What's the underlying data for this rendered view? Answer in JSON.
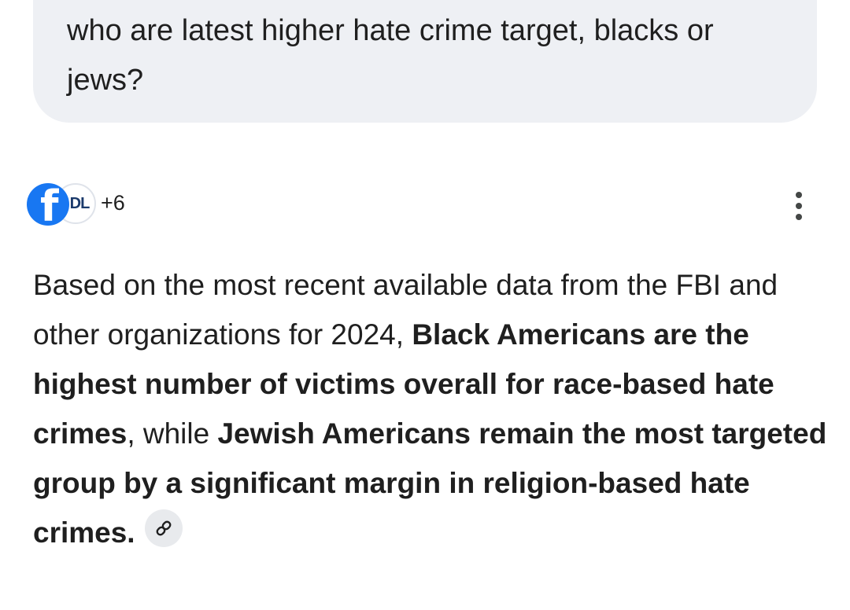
{
  "user_prompt": {
    "text": "who are latest higher hate crime target, blacks or jews?"
  },
  "sources": {
    "icons": [
      "facebook-icon",
      "adl-icon"
    ],
    "first_icon_letter": "f",
    "second_icon_label": "DL",
    "more_count": "+6"
  },
  "menu": {
    "icon": "more-vert-icon"
  },
  "answer": {
    "part1": "Based on the most recent available data from the FBI and other organizations for 2024, ",
    "bold1": "Black Americans are the highest number of victims overall for race-based hate crimes",
    "part2": ", while ",
    "bold2": "Jewish Americans remain the most targeted group by a significant margin in religion-based hate crimes.",
    "link_icon": "link-icon"
  },
  "colors": {
    "bubble_bg": "#eef0f4",
    "facebook_blue": "#1877f2",
    "text": "#1f1f1f",
    "chip_bg": "#e8eaed"
  }
}
